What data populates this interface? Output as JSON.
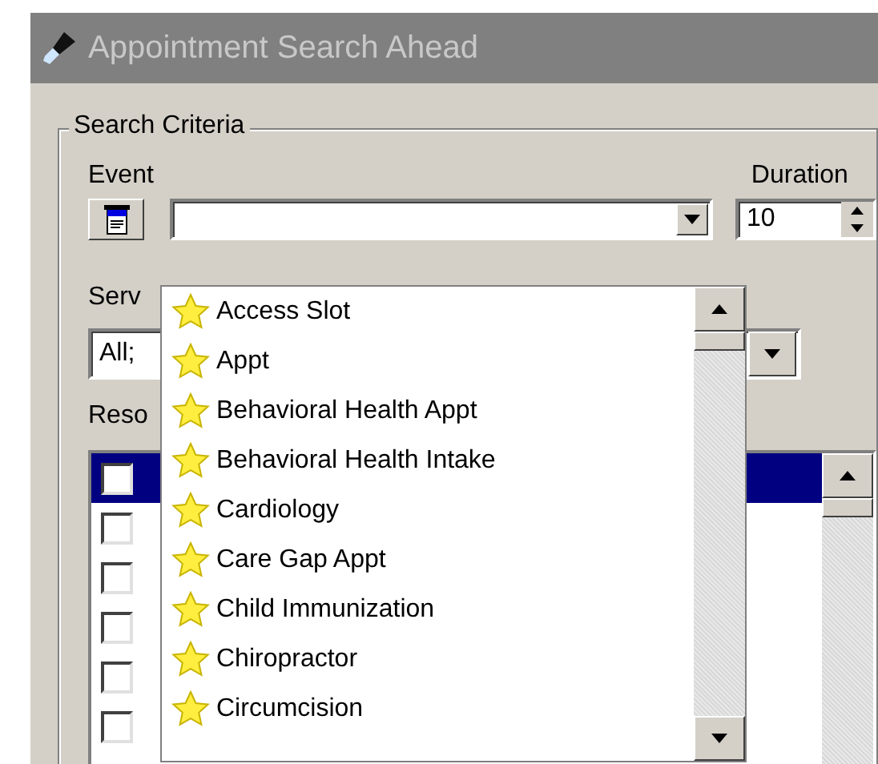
{
  "window": {
    "title": "Appointment Search Ahead"
  },
  "search_criteria": {
    "legend": "Search Criteria",
    "event": {
      "label": "Event"
    },
    "duration": {
      "label": "Duration",
      "value": "10"
    },
    "service": {
      "label": "Serv",
      "value": "All;"
    },
    "resources": {
      "label": "Reso",
      "rows": [
        {
          "checked": false,
          "selected": true
        },
        {
          "checked": false,
          "selected": false
        },
        {
          "checked": false,
          "selected": false
        },
        {
          "checked": false,
          "selected": false
        },
        {
          "checked": false,
          "selected": false
        },
        {
          "checked": false,
          "selected": false
        }
      ]
    }
  },
  "event_dropdown": {
    "items": [
      {
        "label": "Access Slot"
      },
      {
        "label": "Appt"
      },
      {
        "label": "Behavioral Health Appt"
      },
      {
        "label": "Behavioral Health Intake"
      },
      {
        "label": "Cardiology"
      },
      {
        "label": "Care Gap Appt"
      },
      {
        "label": "Child Immunization"
      },
      {
        "label": "Chiropractor"
      },
      {
        "label": "Circumcision"
      }
    ]
  }
}
